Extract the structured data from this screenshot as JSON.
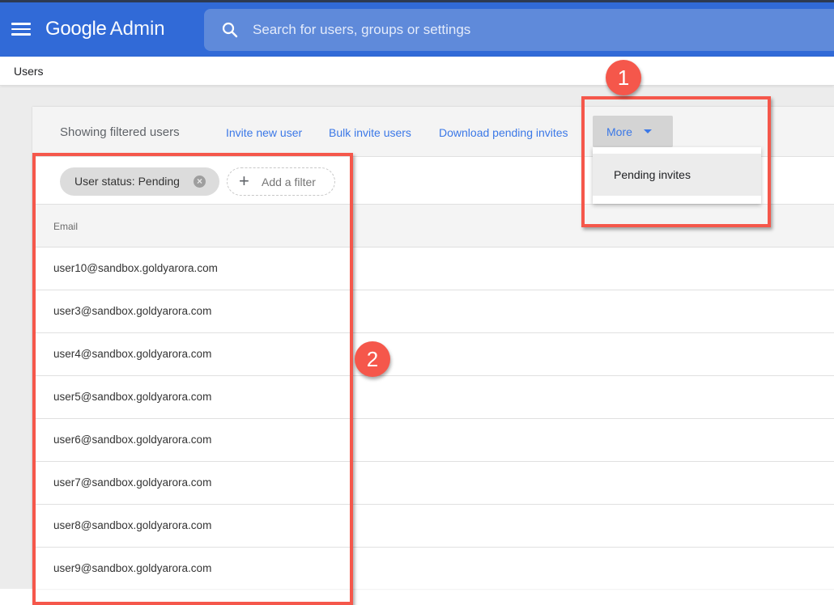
{
  "header": {
    "menu_icon": "hamburger-menu-icon",
    "brand_google": "Google",
    "brand_product": "Admin",
    "search": {
      "icon": "search-icon",
      "placeholder": "Search for users, groups or settings",
      "value": ""
    }
  },
  "breadcrumb": "Users",
  "toolbar": {
    "title": "Showing filtered users",
    "links": [
      "Invite new user",
      "Bulk invite users",
      "Download pending invites"
    ],
    "more_label": "More",
    "more_icon": "caret-down-icon"
  },
  "filters": {
    "active_chip": "User status: Pending",
    "chip_remove_icon": "close-circle-icon",
    "add_filter_label": "Add a filter",
    "add_icon": "plus-icon"
  },
  "dropdown": {
    "items": [
      "Pending invites"
    ]
  },
  "table": {
    "columns": [
      "Email"
    ],
    "rows": [
      "user10@sandbox.goldyarora.com",
      "user3@sandbox.goldyarora.com",
      "user4@sandbox.goldyarora.com",
      "user5@sandbox.goldyarora.com",
      "user6@sandbox.goldyarora.com",
      "user7@sandbox.goldyarora.com",
      "user8@sandbox.goldyarora.com",
      "user9@sandbox.goldyarora.com"
    ]
  },
  "annotations": {
    "badge1": "1",
    "badge2": "2",
    "color": "#f5574b"
  },
  "colors": {
    "header_bg": "#316ad7",
    "search_bg": "#5f8ada",
    "link": "#3b78e7"
  }
}
